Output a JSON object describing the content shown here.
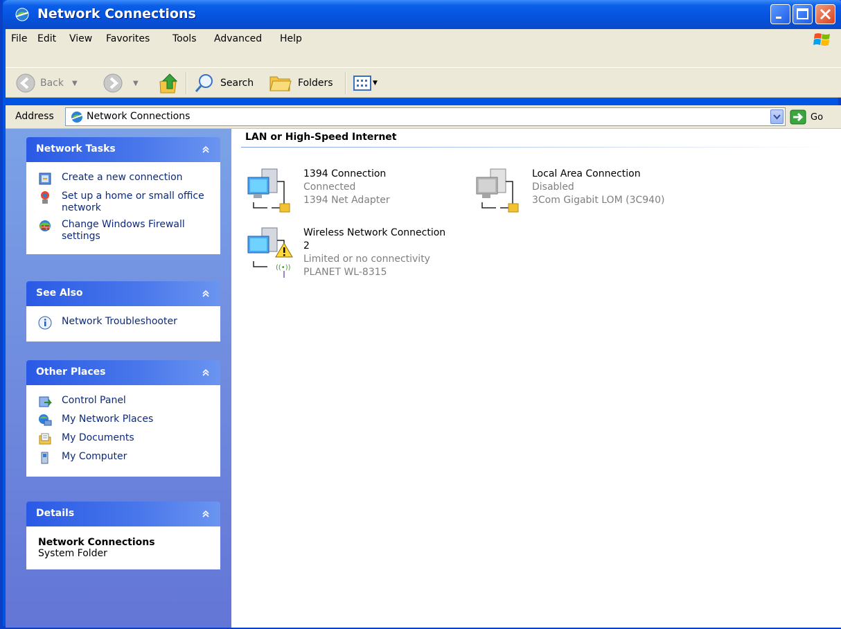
{
  "window": {
    "title": "Network Connections"
  },
  "menu": {
    "items": [
      {
        "label": "File"
      },
      {
        "label": "Edit"
      },
      {
        "label": "View"
      },
      {
        "label": "Favorites"
      },
      {
        "label": "Tools"
      },
      {
        "label": "Advanced"
      },
      {
        "label": "Help"
      }
    ]
  },
  "toolbar": {
    "back_label": "Back",
    "search_label": "Search",
    "folders_label": "Folders"
  },
  "address": {
    "label": "Address",
    "value": "Network Connections",
    "go_label": "Go"
  },
  "sidebar": {
    "network_tasks": {
      "title": "Network Tasks",
      "items": [
        {
          "label": "Create a new connection",
          "icon": "new-connection-icon"
        },
        {
          "label": "Set up a home or small office network",
          "icon": "home-network-icon"
        },
        {
          "label": "Change Windows Firewall settings",
          "icon": "firewall-icon"
        }
      ]
    },
    "see_also": {
      "title": "See Also",
      "items": [
        {
          "label": "Network Troubleshooter",
          "icon": "info-icon"
        }
      ]
    },
    "other_places": {
      "title": "Other Places",
      "items": [
        {
          "label": "Control Panel",
          "icon": "control-panel-icon"
        },
        {
          "label": "My Network Places",
          "icon": "network-places-icon"
        },
        {
          "label": "My Documents",
          "icon": "documents-icon"
        },
        {
          "label": "My Computer",
          "icon": "computer-icon"
        }
      ]
    },
    "details": {
      "title": "Details",
      "name": "Network Connections",
      "type": "System Folder"
    }
  },
  "main": {
    "group_title": "LAN or High-Speed Internet",
    "connections": [
      {
        "name": "1394 Connection",
        "status": "Connected",
        "device": "1394 Net Adapter"
      },
      {
        "name": "Local Area Connection",
        "status": "Disabled",
        "device": "3Com Gigabit LOM (3C940)"
      },
      {
        "name": "Wireless Network Connection 2",
        "status": "Limited or no connectivity",
        "device": "PLANET WL-8315"
      }
    ]
  },
  "colors": {
    "title_blue": "#0553de",
    "sidebar_blue": "#6375d6",
    "link_blue": "#0c2a7b",
    "chrome": "#ece9d8"
  }
}
